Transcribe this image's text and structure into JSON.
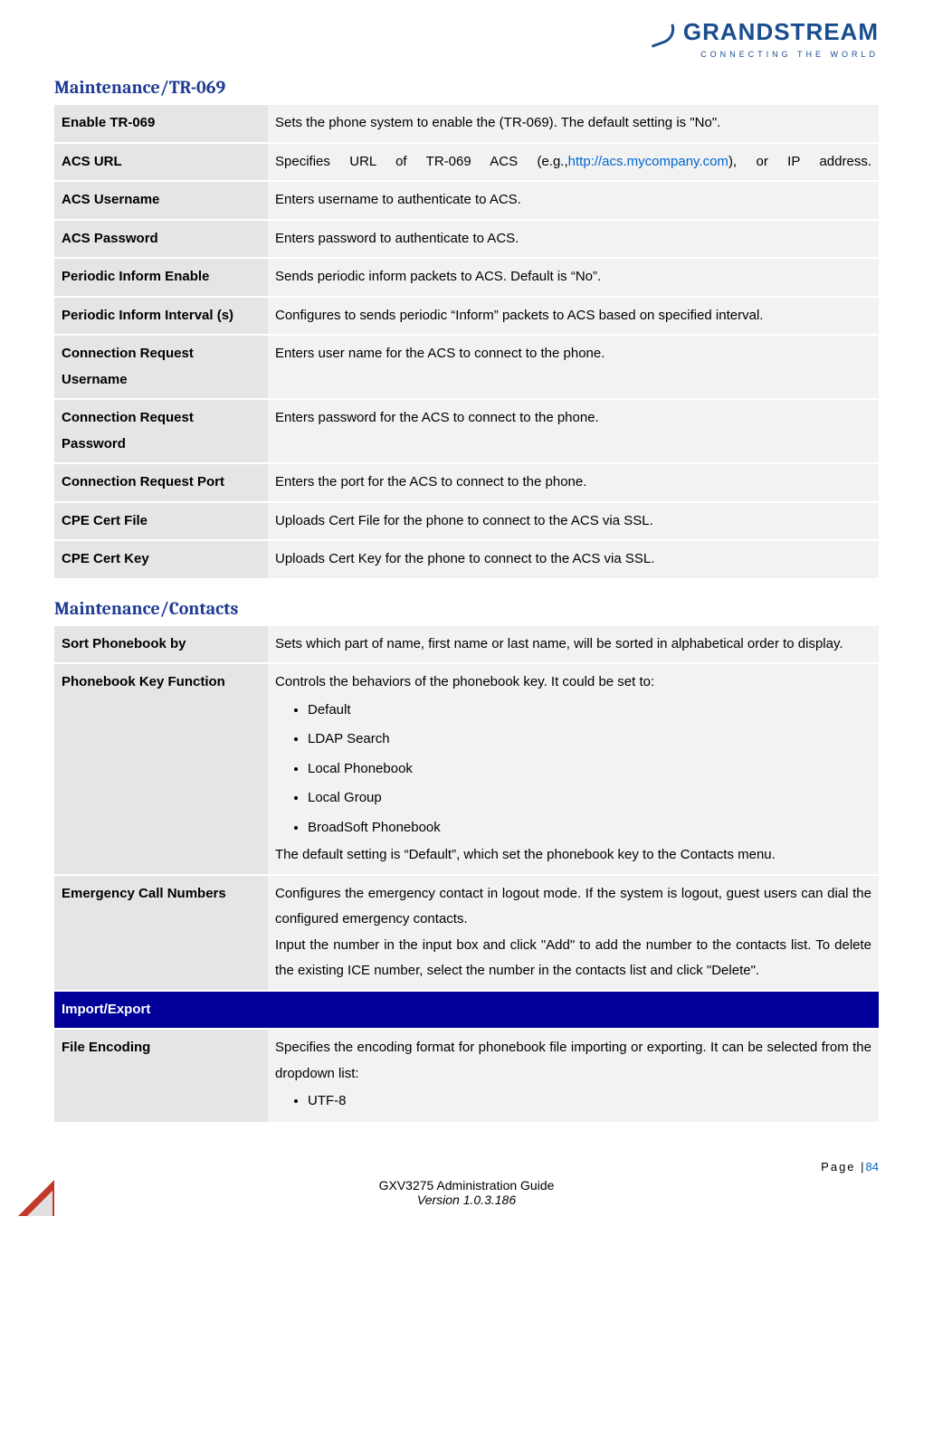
{
  "logo": {
    "brand": "GRANDSTREAM",
    "tagline": "CONNECTING THE WORLD"
  },
  "section1_title": "Maintenance/TR-069",
  "tr069_rows": [
    {
      "label": "Enable TR-069",
      "desc": "Sets the phone system to enable the (TR-069). The default setting is \"No\"."
    },
    {
      "label": "ACS URL",
      "desc_pre": "Specifies URL of TR-069 ACS (e.g.,",
      "link": "http://acs.mycompany.com",
      "desc_post": "), or IP address."
    },
    {
      "label": "ACS Username",
      "desc": "Enters username to authenticate to ACS."
    },
    {
      "label": "ACS Password",
      "desc": "Enters password to authenticate to ACS."
    },
    {
      "label": "Periodic Inform Enable",
      "desc": "Sends periodic inform packets to ACS. Default is “No”."
    },
    {
      "label": "Periodic Inform Interval (s)",
      "desc": "Configures to sends periodic “Inform” packets to ACS based on specified interval."
    },
    {
      "label": "Connection Request Username",
      "desc": "Enters user name for the ACS to connect to the phone."
    },
    {
      "label": "Connection Request Password",
      "desc": "Enters password for the ACS to connect to the phone."
    },
    {
      "label": "Connection Request Port",
      "desc": "Enters the port for the ACS to connect to the phone."
    },
    {
      "label": "CPE Cert File",
      "desc": "Uploads Cert File for the phone to connect to the ACS via SSL."
    },
    {
      "label": "CPE Cert Key",
      "desc": "Uploads Cert Key for the phone to connect to the ACS via SSL."
    }
  ],
  "section2_title": "Maintenance/Contacts",
  "contacts_rows": {
    "sort": {
      "label": "Sort Phonebook by",
      "desc": "Sets which part of name, first name or last name, will be sorted in alphabetical order to display."
    },
    "pbkey": {
      "label": "Phonebook Key Function",
      "intro": "Controls the behaviors of the phonebook key. It could be set to:",
      "items": [
        "Default",
        "LDAP Search",
        "Local Phonebook",
        "Local Group",
        "BroadSoft Phonebook"
      ],
      "outro": "The default setting is “Default”, which set the phonebook key to the Contacts menu."
    },
    "emergency": {
      "label": "Emergency Call Numbers",
      "p1": "Configures the emergency contact in logout mode. If the system is logout, guest users can dial the configured emergency contacts.",
      "p2": "Input the number in the input box and click \"Add\" to add the number to the contacts list. To delete the existing ICE number, select the number in the contacts list and click \"Delete\"."
    },
    "import_header": "Import/Export",
    "file_enc": {
      "label": "File Encoding",
      "intro": "Specifies the encoding format for phonebook file importing or exporting. It can be selected from the dropdown list:",
      "items": [
        "UTF-8"
      ]
    }
  },
  "footer": {
    "page_label": "Page |",
    "page_num": "84",
    "guide_title": "GXV3275 Administration Guide",
    "version": "Version 1.0.3.186"
  }
}
